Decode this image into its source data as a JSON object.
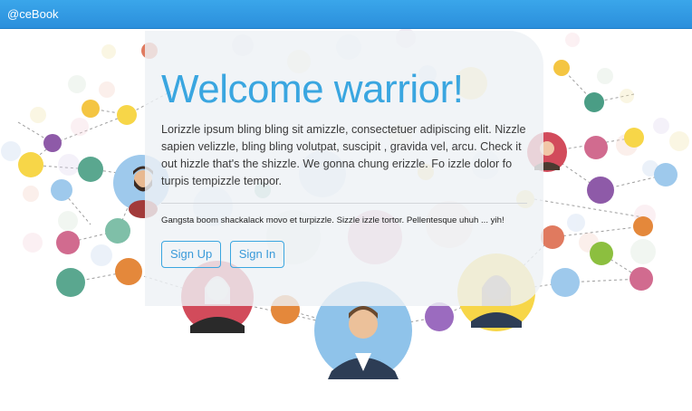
{
  "navbar": {
    "brand": "@ceBook"
  },
  "hero": {
    "title": "Welcome warrior!",
    "lead": "Lorizzle ipsum bling bling sit amizzle, consectetuer adipiscing elit. Nizzle sapien velizzle, bling bling volutpat, suscipit , gravida vel, arcu. Check it out hizzle that's the shizzle. We gonna chung erizzle. Fo izzle dolor fo turpis tempizzle tempor.",
    "tagline": "Gangsta boom shackalack movo et turpizzle. Sizzle izzle tortor. Pellentesque uhuh ... yih!",
    "signup_label": "Sign Up",
    "signin_label": "Sign In"
  },
  "colors": {
    "navbar": "#2b8fdc",
    "accent": "#3aa6e0",
    "panel": "#eef1f5"
  },
  "background": {
    "illustration": "social-network-people-circles"
  }
}
